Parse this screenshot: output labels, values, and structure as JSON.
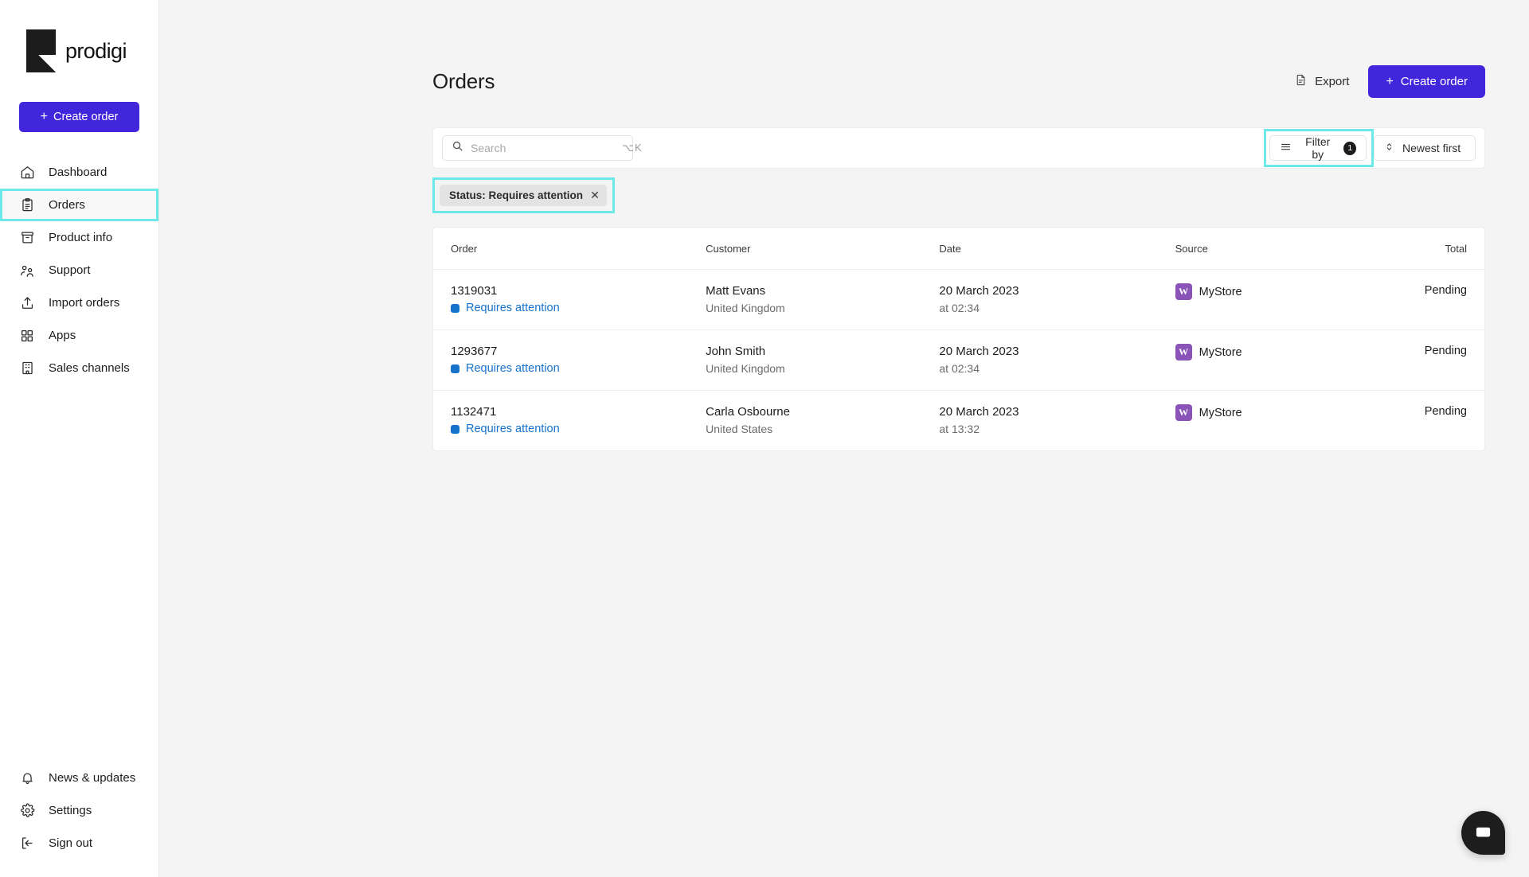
{
  "brand": {
    "name": "prodigi",
    "logo_icon": "prodigi-logo"
  },
  "sidebar": {
    "create_order_label": "Create order",
    "items": [
      {
        "label": "Dashboard",
        "icon": "home-icon"
      },
      {
        "label": "Orders",
        "icon": "clipboard-icon"
      },
      {
        "label": "Product info",
        "icon": "archive-box-icon"
      },
      {
        "label": "Support",
        "icon": "people-icon"
      },
      {
        "label": "Import orders",
        "icon": "upload-icon"
      },
      {
        "label": "Apps",
        "icon": "grid-icon"
      },
      {
        "label": "Sales channels",
        "icon": "building-icon"
      }
    ],
    "bottom_items": [
      {
        "label": "News & updates",
        "icon": "bell-icon"
      },
      {
        "label": "Settings",
        "icon": "gear-icon"
      },
      {
        "label": "Sign out",
        "icon": "sign-out-icon"
      }
    ],
    "active_item": "Orders"
  },
  "header": {
    "title": "Orders",
    "export_label": "Export",
    "create_order_label": "Create order"
  },
  "toolbar": {
    "search_placeholder": "Search",
    "search_value": "",
    "search_shortcut": "⌥K",
    "filter_label": "Filter by",
    "filter_count": "1",
    "sort_label": "Newest first"
  },
  "filter_chips": [
    {
      "label": "Status: Requires attention",
      "remove_icon": "close-icon"
    }
  ],
  "table": {
    "columns": [
      "Order",
      "Customer",
      "Date",
      "Source",
      "Total"
    ],
    "rows": [
      {
        "order_id": "1319031",
        "status": "Requires attention",
        "customer_name": "Matt Evans",
        "customer_country": "United Kingdom",
        "date": "20 March 2023",
        "time": "at 02:34",
        "source": "MyStore",
        "source_icon": "woocommerce-icon",
        "total": "Pending"
      },
      {
        "order_id": "1293677",
        "status": "Requires attention",
        "customer_name": "John Smith",
        "customer_country": "United Kingdom",
        "date": "20 March 2023",
        "time": "at 02:34",
        "source": "MyStore",
        "source_icon": "woocommerce-icon",
        "total": "Pending"
      },
      {
        "order_id": "1132471",
        "status": "Requires attention",
        "customer_name": "Carla Osbourne",
        "customer_country": "United States",
        "date": "20 March 2023",
        "time": "at 13:32",
        "source": "MyStore",
        "source_icon": "woocommerce-icon",
        "total": "Pending"
      }
    ]
  },
  "chat": {
    "icon": "chat-bubble-icon"
  },
  "colors": {
    "brand_purple": "#4226dc",
    "status_blue": "#1672cb",
    "highlight_cyan": "#6ee9e9",
    "woocommerce_purple": "#8a53b7",
    "page_background": "#f4f4f4"
  }
}
